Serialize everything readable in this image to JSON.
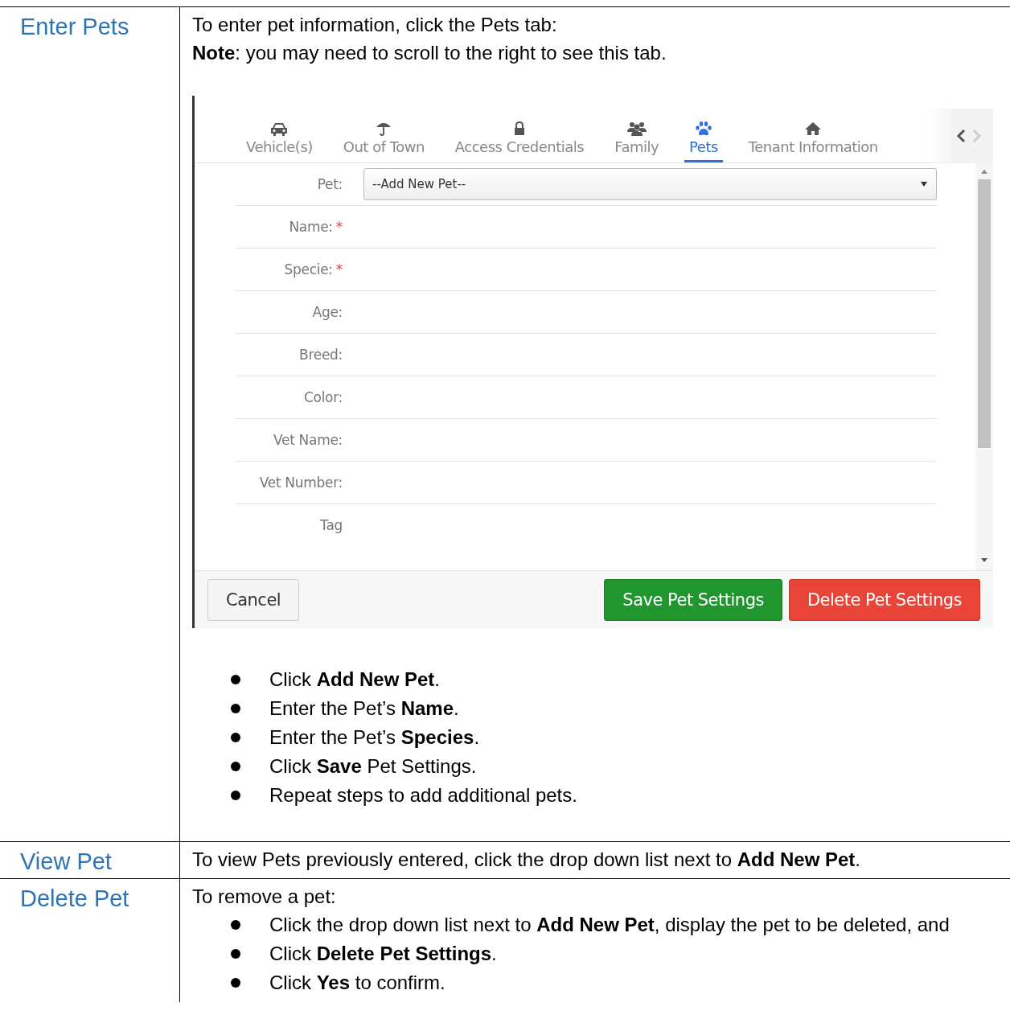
{
  "sections": [
    {
      "title": "Enter Pets",
      "blocks": [
        {
          "kind": "paragraph",
          "text": "To enter pet information, click the Pets tab:"
        },
        {
          "kind": "paragraph",
          "text": "**Note**: you may need to scroll to the right to see this tab."
        },
        {
          "kind": "screenshot",
          "tabs": [
            {
              "label": "Vehicle(s)",
              "selected": false
            },
            {
              "label": "Out of Town",
              "selected": false
            },
            {
              "label": "Access Credentials",
              "selected": false
            },
            {
              "label": "Family",
              "selected": false
            },
            {
              "label": "Pets",
              "selected": true
            },
            {
              "label": "Tenant Information",
              "selected": false
            }
          ],
          "fields": [
            {
              "label": "Pet:",
              "kind": "select",
              "value": "--Add New Pet--"
            },
            {
              "label": "Name:",
              "kind": "text",
              "required_mark": "*"
            },
            {
              "label": "Specie:",
              "kind": "text",
              "required_mark": "*"
            },
            {
              "label": "Age:",
              "kind": "text"
            },
            {
              "label": "Breed:",
              "kind": "text"
            },
            {
              "label": "Color:",
              "kind": "text"
            },
            {
              "label": "Vet Name:",
              "kind": "text"
            },
            {
              "label": "Vet Number:",
              "kind": "text"
            },
            {
              "label": "Tag",
              "kind": "text"
            }
          ],
          "buttons": [
            {
              "label": "Cancel",
              "kind": "default"
            },
            {
              "label": "Save Pet Settings",
              "kind": "success"
            },
            {
              "label": "Delete Pet Settings",
              "kind": "danger"
            }
          ]
        },
        {
          "kind": "bullets",
          "items": [
            "Click **Add New Pet**.",
            "Enter the Pet’s **Name**.",
            "Enter the Pet’s **Species**.",
            "Click **Save** Pet Settings.",
            "Repeat steps to add additional pets."
          ]
        }
      ]
    },
    {
      "title": "View Pet",
      "blocks": [
        {
          "kind": "paragraph",
          "text": "To view Pets previously entered, click the drop down list next to **Add New Pet**."
        }
      ]
    },
    {
      "title": "Delete Pet",
      "blocks": [
        {
          "kind": "paragraph",
          "text": "To remove a pet:"
        },
        {
          "kind": "bullets",
          "items": [
            "Click the drop down list next to **Add New Pet**, display the pet to be deleted, and",
            "Click **Delete Pet Settings**.",
            "Click **Yes** to confirm."
          ]
        }
      ]
    }
  ]
}
